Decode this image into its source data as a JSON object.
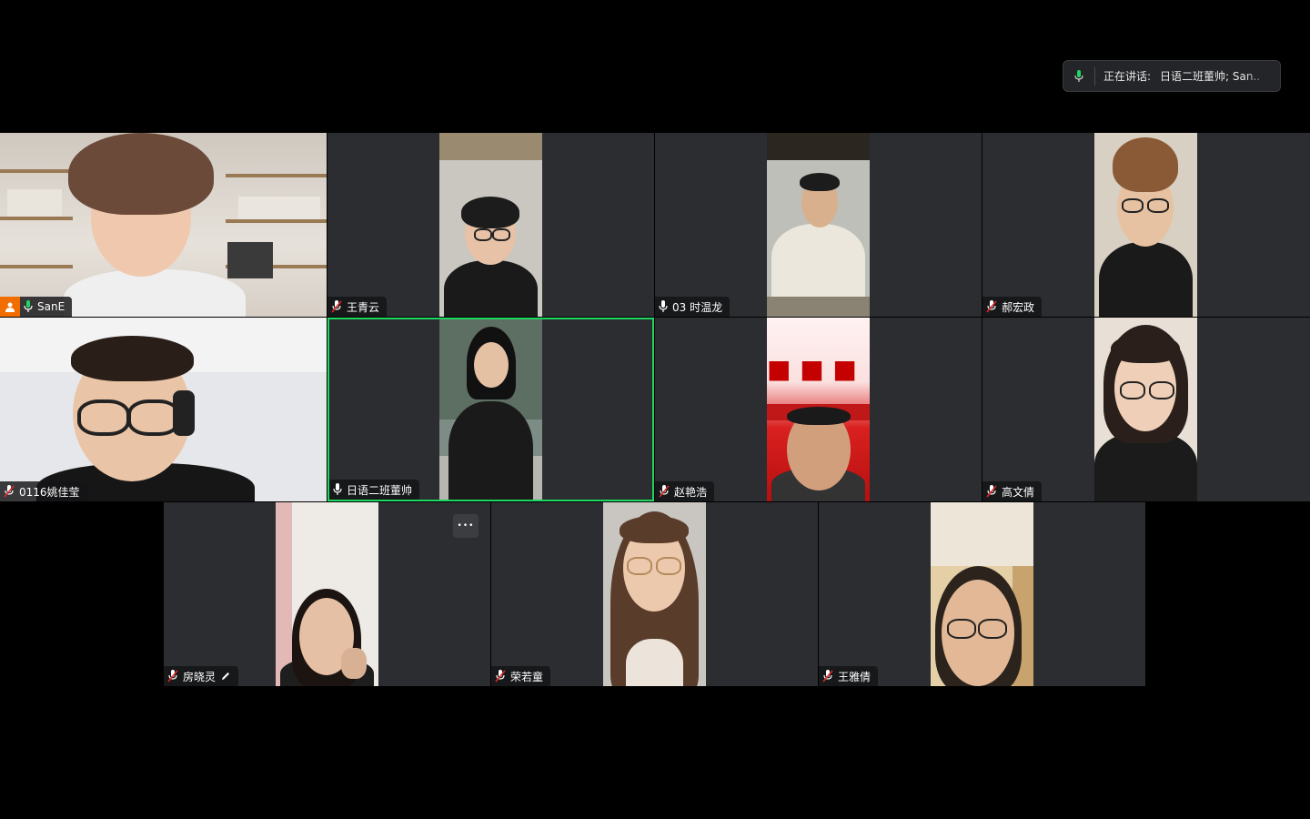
{
  "speaking": {
    "label": "正在讲话:",
    "names": "日语二班董帅; San.."
  },
  "participants": [
    {
      "name": "SanE",
      "mic": "on",
      "host": true
    },
    {
      "name": "王青云",
      "mic": "muted"
    },
    {
      "name": "03 时温龙",
      "mic": "on"
    },
    {
      "name": "郝宏政",
      "mic": "muted"
    },
    {
      "name": "0116姚佳莹",
      "mic": "muted"
    },
    {
      "name": "日语二班董帅",
      "mic": "on",
      "active": true
    },
    {
      "name": "赵艳浩",
      "mic": "muted"
    },
    {
      "name": "高文倩",
      "mic": "muted"
    },
    {
      "name": "房晓灵",
      "mic": "muted",
      "editing": true
    },
    {
      "name": "荣若童",
      "mic": "muted"
    },
    {
      "name": "王雅倩",
      "mic": "muted"
    }
  ],
  "more_button": "•••",
  "colors": {
    "active_border": "#1ed760",
    "host_badge": "#f26d00",
    "tile_bg": "#2b2d31",
    "mic_on": "#1ed760",
    "mic_muted": "#e02828"
  }
}
